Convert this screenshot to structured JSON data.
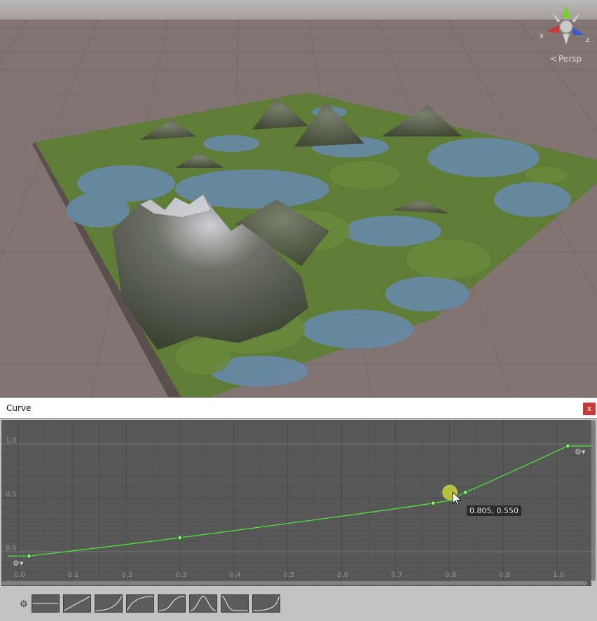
{
  "scene": {
    "projection_label": "Persp",
    "axis_x_label": "x",
    "axis_z_label": "z",
    "colors": {
      "ground": "#837572",
      "terrain_grass": "#5a7a34",
      "terrain_water": "#5f86a6",
      "mountain": "#4f5446"
    }
  },
  "curve_window": {
    "title": "Curve",
    "close_label": "x",
    "y_ticks": [
      "1,0",
      "0,5",
      "0,0"
    ],
    "x_ticks": [
      "0,0",
      "0,1",
      "0,2",
      "0,3",
      "0,4",
      "0,5",
      "0,6",
      "0,7",
      "0,8",
      "0,9",
      "1,0"
    ],
    "tooltip": "0.805, 0.550",
    "curve_color": "#4fe13c",
    "presets_icon": "gear-icon",
    "presets": [
      "flat",
      "linear",
      "ease-in",
      "ease-out",
      "ease-in-out",
      "bell",
      "valley",
      "exponential"
    ]
  },
  "chart_data": {
    "type": "line",
    "title": "",
    "xlabel": "",
    "ylabel": "",
    "xlim": [
      0,
      1.05
    ],
    "ylim": [
      -0.1,
      1.1
    ],
    "keys": [
      {
        "x": 0.02,
        "y": -0.04
      },
      {
        "x": 0.3,
        "y": 0.13
      },
      {
        "x": 0.77,
        "y": 0.45
      },
      {
        "x": 0.83,
        "y": 0.55
      },
      {
        "x": 1.02,
        "y": 0.98
      }
    ],
    "selected_key": {
      "x": 0.805,
      "y": 0.55
    }
  }
}
